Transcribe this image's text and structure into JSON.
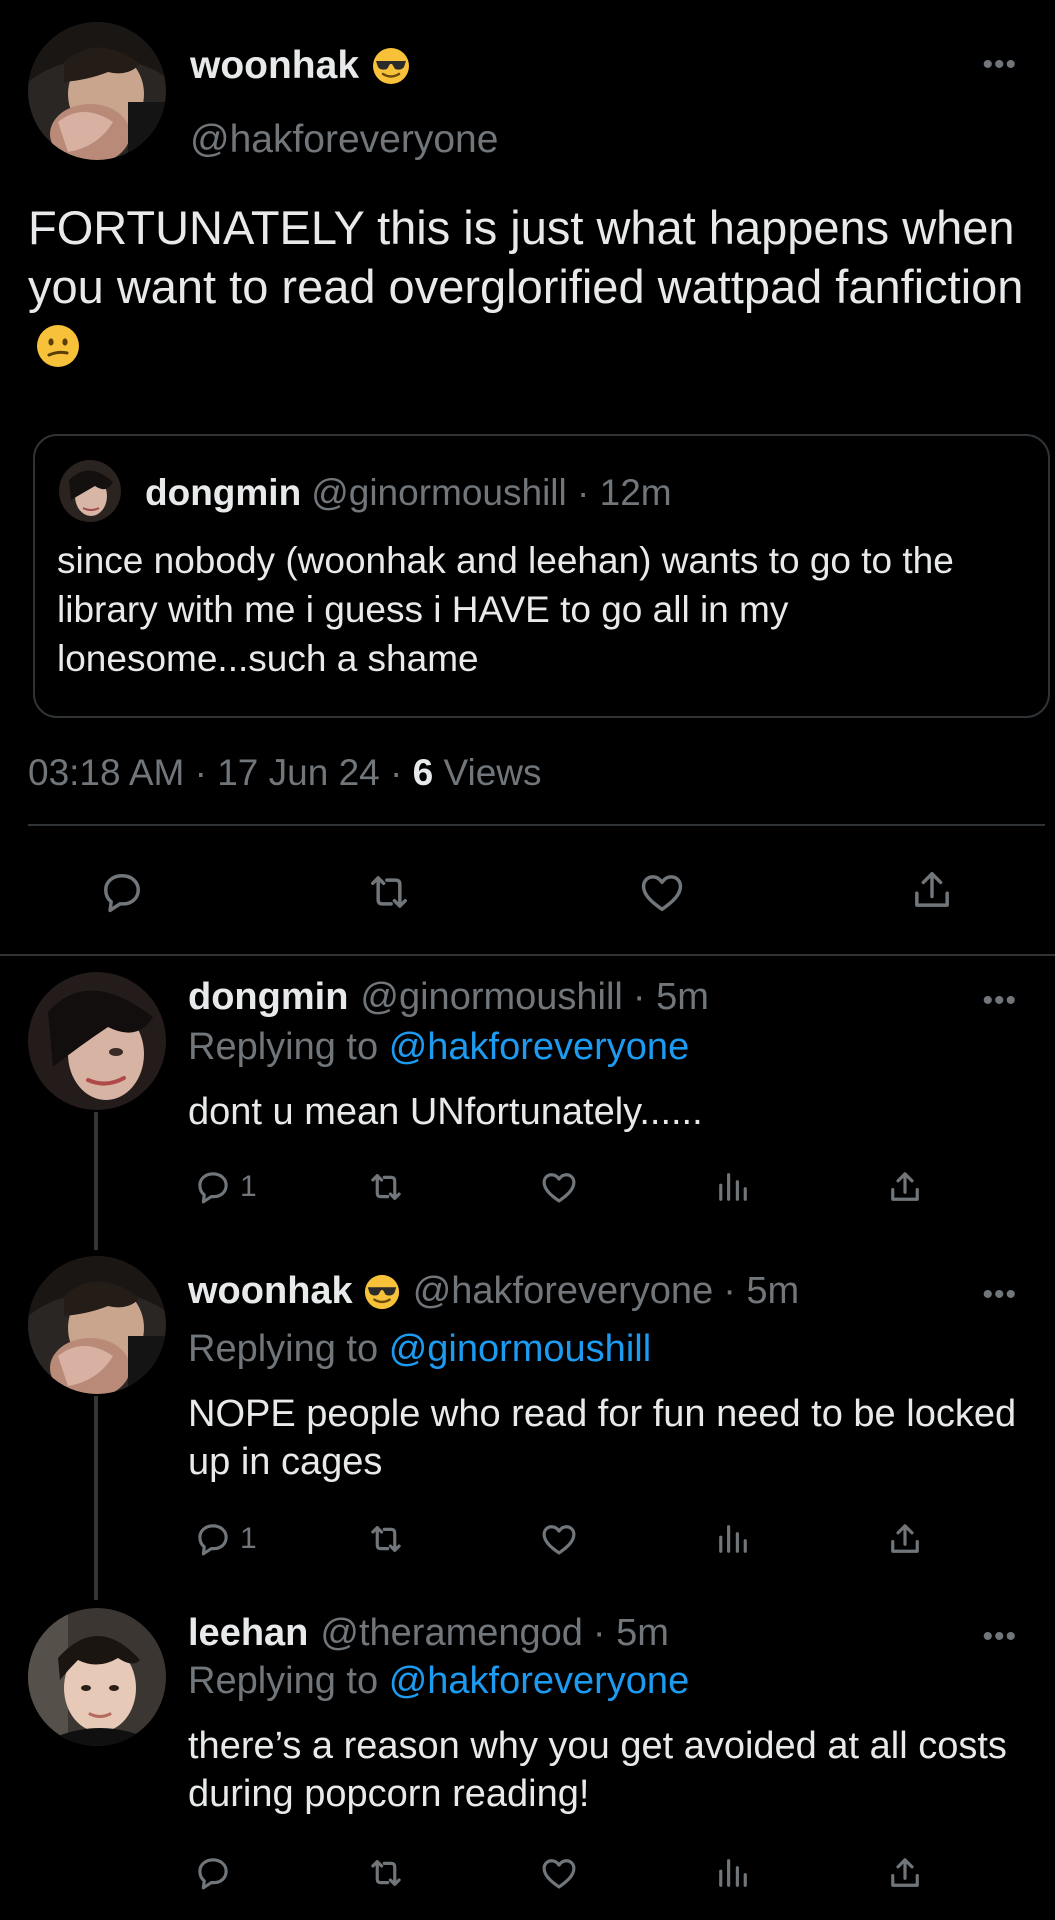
{
  "main_tweet": {
    "name": "woonhak",
    "name_emoji": "sunglasses-emoji",
    "handle": "@hakforeveryone",
    "text": "FORTUNATELY this is just what happens when you want to read overglorified wattpad fanfiction",
    "text_emoji": "confused-face-emoji",
    "quote": {
      "name": "dongmin",
      "handle": "@ginormoushill",
      "time": "· 12m",
      "text": "since nobody (woonhak and leehan) wants to go to the library with me i guess i HAVE to go all in my lonesome...such a shame"
    },
    "time": "03:18 AM",
    "date": "· 17 Jun 24 ·",
    "views_count": "6",
    "views_label": "Views"
  },
  "replies": [
    {
      "name": "dongmin",
      "handle": "@ginormoushill",
      "time": "· 5m",
      "replying_prefix": "Replying to",
      "replying_to": "@hakforeveryone",
      "text": "dont u mean UNfortunately......",
      "reply_count": "1"
    },
    {
      "name": "woonhak",
      "name_emoji": "sunglasses-emoji",
      "handle": "@hakforeveryone",
      "time": "· 5m",
      "replying_prefix": "Replying to",
      "replying_to": "@ginormoushill",
      "text": "NOPE people who read for fun need to be locked up in cages",
      "reply_count": "1"
    },
    {
      "name": "leehan",
      "handle": "@theramengod",
      "time": "· 5m",
      "replying_prefix": "Replying to",
      "replying_to": "@hakforeveryone",
      "text": "there’s a reason why you get avoided at all costs during popcorn reading!",
      "reply_count": ""
    }
  ],
  "more_label": "•••",
  "colors": {
    "background": "#000000",
    "text": "#e7e9ea",
    "secondary": "#71767b",
    "link": "#1d9bf0",
    "border": "#2f3336"
  }
}
